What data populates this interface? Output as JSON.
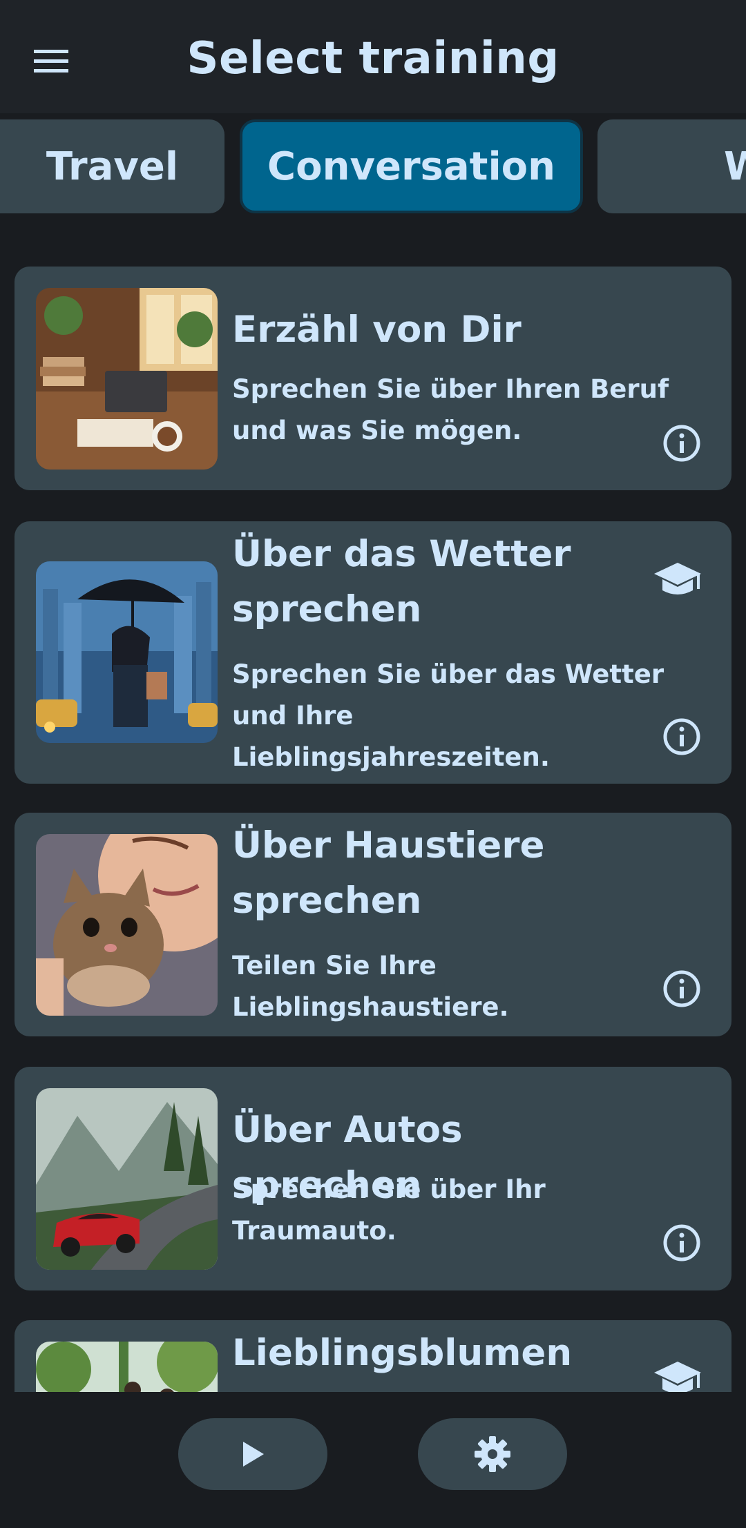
{
  "header": {
    "title": "Select training",
    "menu_icon": "hamburger-menu-icon"
  },
  "tabs": [
    {
      "label": "Travel",
      "active": false
    },
    {
      "label": "Conversation",
      "active": true
    },
    {
      "label": "W",
      "active": false
    }
  ],
  "trainings": [
    {
      "title": "Erzähl von Dir",
      "description": "Sprechen Sie über Ihren Beruf und was Sie mögen.",
      "image": "desk-with-books-laptop-coffee",
      "has_grad_icon": false
    },
    {
      "title": "Über das Wetter sprechen",
      "description": "Sprechen Sie über das Wetter und Ihre Lieblingsjahreszeiten.",
      "image": "girl-with-umbrella-in-rainy-city",
      "has_grad_icon": true
    },
    {
      "title": "Über Haustiere sprechen",
      "description": "Teilen Sie Ihre Lieblingshaustiere.",
      "image": "person-hugging-kitten",
      "has_grad_icon": false
    },
    {
      "title": "Über Autos sprechen",
      "description": "Sprechen Sie über Ihr Traumauto.",
      "image": "red-sports-car-on-mountain-road",
      "has_grad_icon": false
    },
    {
      "title": "Lieblingsblumen",
      "description": "",
      "image": "people-in-garden",
      "has_grad_icon": true
    }
  ],
  "bottom_nav": {
    "play_icon": "play-icon",
    "settings_icon": "gear-icon"
  },
  "colors": {
    "background": "#191c20",
    "app_bar": "#1f2328",
    "card": "#37474f",
    "active_tab": "#00658e",
    "text": "#cfe6fb"
  }
}
